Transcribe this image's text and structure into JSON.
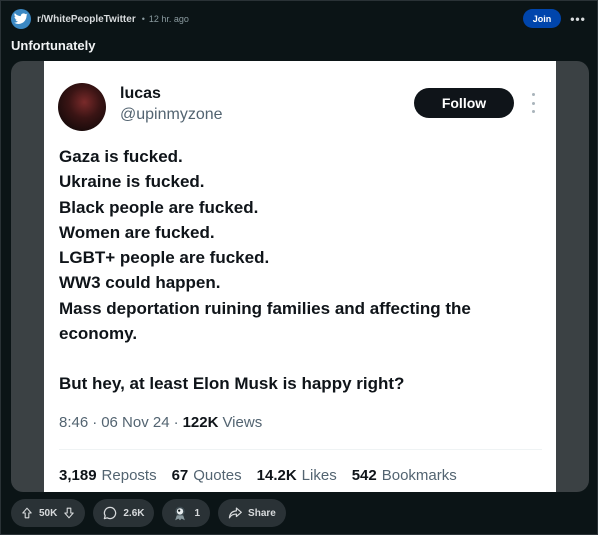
{
  "post": {
    "subreddit": "r/WhitePeopleTwitter",
    "separator": "•",
    "time": "12 hr. ago",
    "join_label": "Join",
    "more_label": "•••",
    "title": "Unfortunately"
  },
  "tweet": {
    "name": "lucas",
    "handle": "@upinmyzone",
    "follow_label": "Follow",
    "lines": [
      "Gaza is fucked.",
      "Ukraine is fucked.",
      "Black people are fucked.",
      "Women are fucked.",
      "LGBT+ people are fucked.",
      "WW3 could happen.",
      "Mass deportation ruining families and affecting the economy."
    ],
    "closing": "But hey, at least Elon Musk is happy right?",
    "time": "8:46",
    "date": "06 Nov 24",
    "meta_sep": "·",
    "views_count": "122K",
    "views_label": "Views",
    "stats": {
      "reposts_count": "3,189",
      "reposts_label": "Reposts",
      "quotes_count": "67",
      "quotes_label": "Quotes",
      "likes_count": "14.2K",
      "likes_label": "Likes",
      "bookmarks_count": "542",
      "bookmarks_label": "Bookmarks"
    }
  },
  "actions": {
    "votes": "50K",
    "comments": "2.6K",
    "awards": "1",
    "share_label": "Share"
  },
  "icons": {
    "subreddit": "subreddit-avatar-bird-icon",
    "upvote": "arrow-up-icon",
    "downvote": "arrow-down-icon",
    "comment": "comment-bubble-icon",
    "award": "award-icon",
    "share": "share-arrow-icon"
  },
  "colors": {
    "background": "#0b1416",
    "join_button": "#0045ac",
    "pill": "#2a3236",
    "tweet_bg": "#ffffff",
    "tweet_text": "#0f1419",
    "tweet_muted": "#536471"
  }
}
